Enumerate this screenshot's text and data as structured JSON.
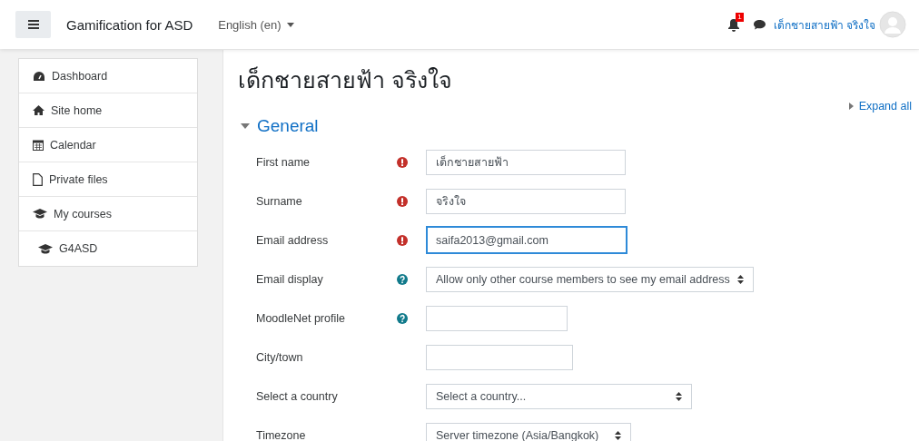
{
  "navbar": {
    "site_name": "Gamification for ASD",
    "language": "English (en)",
    "notification_count": "1",
    "user_name": "เด็กชายสายฟ้า จริงใจ"
  },
  "sidebar": {
    "items": [
      {
        "label": "Dashboard",
        "kind": "dashboard",
        "indented": false
      },
      {
        "label": "Site home",
        "kind": "home",
        "indented": false
      },
      {
        "label": "Calendar",
        "kind": "calendar",
        "indented": false
      },
      {
        "label": "Private files",
        "kind": "file",
        "indented": false
      },
      {
        "label": "My courses",
        "kind": "courses",
        "indented": false
      },
      {
        "label": "G4ASD",
        "kind": "course",
        "indented": true
      }
    ]
  },
  "page": {
    "title": "เด็กชายสายฟ้า จริงใจ",
    "expand_all": "Expand all",
    "section": {
      "title": "General",
      "expanded": true
    },
    "fields": [
      {
        "label": "First name",
        "required": true,
        "has_help": false,
        "kind": "text",
        "value": "เด็กชายสายฟ้า",
        "focused": false
      },
      {
        "label": "Surname",
        "required": true,
        "has_help": false,
        "kind": "text",
        "value": "จริงใจ",
        "focused": false
      },
      {
        "label": "Email address",
        "required": true,
        "has_help": false,
        "kind": "text",
        "value": "saifa2013@gmail.com",
        "focused": true
      },
      {
        "label": "Email display",
        "required": false,
        "has_help": true,
        "kind": "select",
        "value": "Allow only other course members to see my email address",
        "focused": false
      },
      {
        "label": "MoodleNet profile",
        "required": false,
        "has_help": true,
        "kind": "text",
        "focused": false
      },
      {
        "label": "City/town",
        "required": false,
        "has_help": false,
        "kind": "text",
        "focused": false
      },
      {
        "label": "Select a country",
        "required": false,
        "has_help": false,
        "kind": "select",
        "value": "Select a country...",
        "focused": false
      },
      {
        "label": "Timezone",
        "required": false,
        "has_help": false,
        "kind": "select",
        "value": "Server timezone (Asia/Bangkok)",
        "focused": false
      }
    ]
  }
}
